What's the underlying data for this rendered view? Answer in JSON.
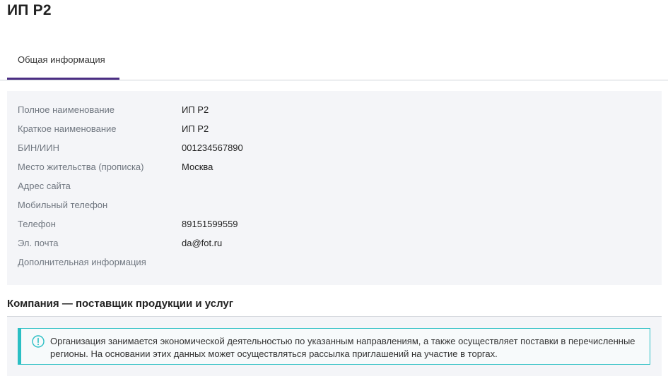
{
  "page": {
    "title": "ИП Р2"
  },
  "tabs": [
    {
      "label": "Общая информация",
      "active": true
    }
  ],
  "info": {
    "rows": [
      {
        "label": "Полное наименование",
        "value": "ИП Р2"
      },
      {
        "label": "Краткое наименование",
        "value": "ИП Р2"
      },
      {
        "label": "БИН/ИИН",
        "value": "001234567890"
      },
      {
        "label": "Место жительства (прописка)",
        "value": "Москва"
      },
      {
        "label": "Адрес сайта",
        "value": ""
      },
      {
        "label": "Мобильный телефон",
        "value": ""
      },
      {
        "label": "Телефон",
        "value": "89151599559"
      },
      {
        "label": "Эл. почта",
        "value": "da@fot.ru"
      },
      {
        "label": "Дополнительная информация",
        "value": ""
      }
    ]
  },
  "supplier_section": {
    "title": "Компания — поставщик продукции и услуг",
    "notice": "Организация занимается экономической деятельностью по указанным направлениям, а также осуществляет поставки в перечисленные регионы. На основании этих данных может осуществляться рассылка приглашений на участие в торгах.",
    "notice_icon": "info-circle-icon"
  },
  "colors": {
    "accent": "#4b2e83",
    "notice_border": "#2bbfc4",
    "panel_bg": "#f4f5f8",
    "label_text": "#707780"
  }
}
